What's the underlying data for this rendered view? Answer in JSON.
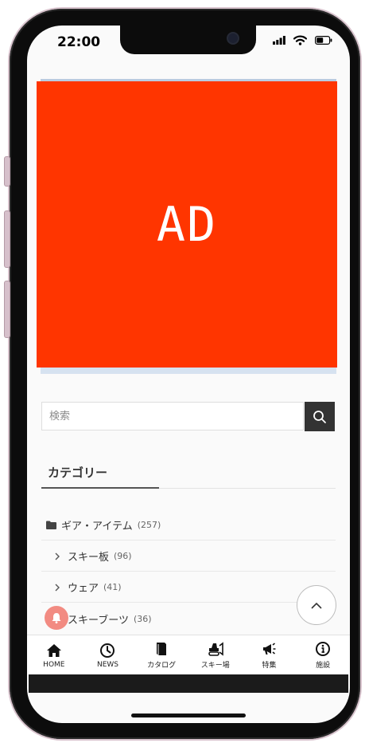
{
  "status_bar": {
    "time": "22:00",
    "icons": [
      "signal-icon",
      "wifi-icon",
      "battery-icon"
    ]
  },
  "ad": {
    "label": "AD",
    "background_color": "#ff3500"
  },
  "search": {
    "placeholder": "検索",
    "button_icon": "search-icon"
  },
  "categories": {
    "heading": "カテゴリー",
    "items": [
      {
        "name": "ギア・アイテム",
        "count": "(257)",
        "icon": "folder-icon"
      },
      {
        "name": "スキー板",
        "count": "(96)",
        "icon": "chevron-right-icon"
      },
      {
        "name": "ウェア",
        "count": "(41)",
        "icon": "chevron-right-icon"
      },
      {
        "name": "スキーブーツ",
        "count": "(36)",
        "icon": "chevron-right-icon"
      }
    ]
  },
  "floating": {
    "scroll_top_icon": "chevron-up-icon",
    "notification_icon": "bell-icon"
  },
  "bottom_nav": [
    {
      "label": "HOME",
      "icon": "home-icon"
    },
    {
      "label": "NEWS",
      "icon": "clock-icon"
    },
    {
      "label": "カタログ",
      "icon": "book-icon"
    },
    {
      "label": "スキー場",
      "icon": "snowplow-icon"
    },
    {
      "label": "特集",
      "icon": "megaphone-icon"
    },
    {
      "label": "施設",
      "icon": "info-icon"
    }
  ]
}
